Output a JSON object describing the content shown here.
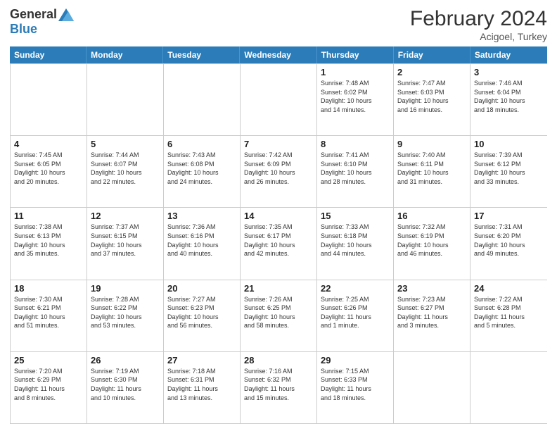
{
  "header": {
    "logo_general": "General",
    "logo_blue": "Blue",
    "main_title": "February 2024",
    "subtitle": "Acigoel, Turkey"
  },
  "days_of_week": [
    "Sunday",
    "Monday",
    "Tuesday",
    "Wednesday",
    "Thursday",
    "Friday",
    "Saturday"
  ],
  "weeks": [
    [
      {
        "day": "",
        "info": ""
      },
      {
        "day": "",
        "info": ""
      },
      {
        "day": "",
        "info": ""
      },
      {
        "day": "",
        "info": ""
      },
      {
        "day": "1",
        "info": "Sunrise: 7:48 AM\nSunset: 6:02 PM\nDaylight: 10 hours\nand 14 minutes."
      },
      {
        "day": "2",
        "info": "Sunrise: 7:47 AM\nSunset: 6:03 PM\nDaylight: 10 hours\nand 16 minutes."
      },
      {
        "day": "3",
        "info": "Sunrise: 7:46 AM\nSunset: 6:04 PM\nDaylight: 10 hours\nand 18 minutes."
      }
    ],
    [
      {
        "day": "4",
        "info": "Sunrise: 7:45 AM\nSunset: 6:05 PM\nDaylight: 10 hours\nand 20 minutes."
      },
      {
        "day": "5",
        "info": "Sunrise: 7:44 AM\nSunset: 6:07 PM\nDaylight: 10 hours\nand 22 minutes."
      },
      {
        "day": "6",
        "info": "Sunrise: 7:43 AM\nSunset: 6:08 PM\nDaylight: 10 hours\nand 24 minutes."
      },
      {
        "day": "7",
        "info": "Sunrise: 7:42 AM\nSunset: 6:09 PM\nDaylight: 10 hours\nand 26 minutes."
      },
      {
        "day": "8",
        "info": "Sunrise: 7:41 AM\nSunset: 6:10 PM\nDaylight: 10 hours\nand 28 minutes."
      },
      {
        "day": "9",
        "info": "Sunrise: 7:40 AM\nSunset: 6:11 PM\nDaylight: 10 hours\nand 31 minutes."
      },
      {
        "day": "10",
        "info": "Sunrise: 7:39 AM\nSunset: 6:12 PM\nDaylight: 10 hours\nand 33 minutes."
      }
    ],
    [
      {
        "day": "11",
        "info": "Sunrise: 7:38 AM\nSunset: 6:13 PM\nDaylight: 10 hours\nand 35 minutes."
      },
      {
        "day": "12",
        "info": "Sunrise: 7:37 AM\nSunset: 6:15 PM\nDaylight: 10 hours\nand 37 minutes."
      },
      {
        "day": "13",
        "info": "Sunrise: 7:36 AM\nSunset: 6:16 PM\nDaylight: 10 hours\nand 40 minutes."
      },
      {
        "day": "14",
        "info": "Sunrise: 7:35 AM\nSunset: 6:17 PM\nDaylight: 10 hours\nand 42 minutes."
      },
      {
        "day": "15",
        "info": "Sunrise: 7:33 AM\nSunset: 6:18 PM\nDaylight: 10 hours\nand 44 minutes."
      },
      {
        "day": "16",
        "info": "Sunrise: 7:32 AM\nSunset: 6:19 PM\nDaylight: 10 hours\nand 46 minutes."
      },
      {
        "day": "17",
        "info": "Sunrise: 7:31 AM\nSunset: 6:20 PM\nDaylight: 10 hours\nand 49 minutes."
      }
    ],
    [
      {
        "day": "18",
        "info": "Sunrise: 7:30 AM\nSunset: 6:21 PM\nDaylight: 10 hours\nand 51 minutes."
      },
      {
        "day": "19",
        "info": "Sunrise: 7:28 AM\nSunset: 6:22 PM\nDaylight: 10 hours\nand 53 minutes."
      },
      {
        "day": "20",
        "info": "Sunrise: 7:27 AM\nSunset: 6:23 PM\nDaylight: 10 hours\nand 56 minutes."
      },
      {
        "day": "21",
        "info": "Sunrise: 7:26 AM\nSunset: 6:25 PM\nDaylight: 10 hours\nand 58 minutes."
      },
      {
        "day": "22",
        "info": "Sunrise: 7:25 AM\nSunset: 6:26 PM\nDaylight: 11 hours\nand 1 minute."
      },
      {
        "day": "23",
        "info": "Sunrise: 7:23 AM\nSunset: 6:27 PM\nDaylight: 11 hours\nand 3 minutes."
      },
      {
        "day": "24",
        "info": "Sunrise: 7:22 AM\nSunset: 6:28 PM\nDaylight: 11 hours\nand 5 minutes."
      }
    ],
    [
      {
        "day": "25",
        "info": "Sunrise: 7:20 AM\nSunset: 6:29 PM\nDaylight: 11 hours\nand 8 minutes."
      },
      {
        "day": "26",
        "info": "Sunrise: 7:19 AM\nSunset: 6:30 PM\nDaylight: 11 hours\nand 10 minutes."
      },
      {
        "day": "27",
        "info": "Sunrise: 7:18 AM\nSunset: 6:31 PM\nDaylight: 11 hours\nand 13 minutes."
      },
      {
        "day": "28",
        "info": "Sunrise: 7:16 AM\nSunset: 6:32 PM\nDaylight: 11 hours\nand 15 minutes."
      },
      {
        "day": "29",
        "info": "Sunrise: 7:15 AM\nSunset: 6:33 PM\nDaylight: 11 hours\nand 18 minutes."
      },
      {
        "day": "",
        "info": ""
      },
      {
        "day": "",
        "info": ""
      }
    ]
  ]
}
